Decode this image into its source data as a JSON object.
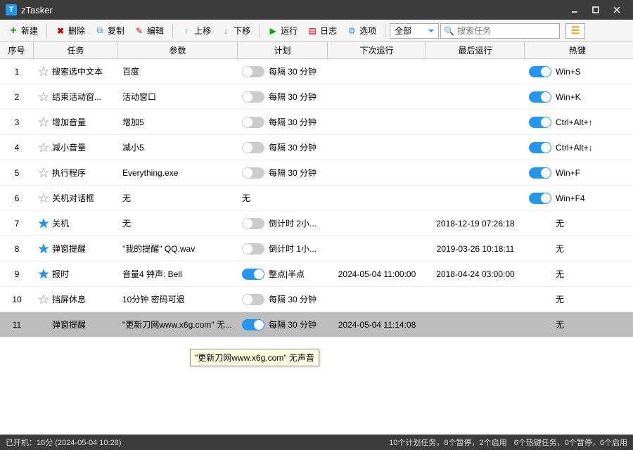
{
  "title": "zTasker",
  "toolbar": {
    "new": "新建",
    "delete": "删除",
    "copy": "复制",
    "edit": "编辑",
    "up": "上移",
    "down": "下移",
    "run": "运行",
    "log": "日志",
    "options": "选项",
    "filter_selected": "全部",
    "search_placeholder": "搜索任务"
  },
  "columns": {
    "num": "序号",
    "task": "任务",
    "param": "参数",
    "plan": "计划",
    "next": "下次运行",
    "last": "最后运行",
    "hotkey": "热键"
  },
  "rows": [
    {
      "num": "1",
      "starred": false,
      "task": "搜索选中文本",
      "param": "百度",
      "planOn": false,
      "plan": "每隔 30 分钟",
      "next": "",
      "last": "",
      "hkOn": true,
      "hotkey": "Win+S"
    },
    {
      "num": "2",
      "starred": false,
      "task": "结束活动窗...",
      "param": "活动窗口",
      "planOn": false,
      "plan": "每隔 30 分钟",
      "next": "",
      "last": "",
      "hkOn": true,
      "hotkey": "Win+K"
    },
    {
      "num": "3",
      "starred": false,
      "task": "增加音量",
      "param": "增加5",
      "planOn": false,
      "plan": "每隔 30 分钟",
      "next": "",
      "last": "",
      "hkOn": true,
      "hotkey": "Ctrl+Alt+↑"
    },
    {
      "num": "4",
      "starred": false,
      "task": "减小音量",
      "param": "减小5",
      "planOn": false,
      "plan": "每隔 30 分钟",
      "next": "",
      "last": "",
      "hkOn": true,
      "hotkey": "Ctrl+Alt+↓"
    },
    {
      "num": "5",
      "starred": false,
      "task": "执行程序",
      "param": "Everything.exe",
      "planOn": false,
      "plan": "每隔 30 分钟",
      "next": "",
      "last": "",
      "hkOn": true,
      "hotkey": "Win+F"
    },
    {
      "num": "6",
      "starred": false,
      "task": "关机对话框",
      "param": "无",
      "planOn": false,
      "plan": "无",
      "next": "",
      "last": "",
      "hkOn": true,
      "hotkey": "Win+F4"
    },
    {
      "num": "7",
      "starred": true,
      "task": "关机",
      "param": "无",
      "planOn": false,
      "plan": "倒计时 2小...",
      "next": "",
      "last": "2018-12-19 07:26:18",
      "hkOn": false,
      "hotkey": "无"
    },
    {
      "num": "8",
      "starred": true,
      "task": "弹窗提醒",
      "param": "\"我的提醒\" QQ.wav",
      "planOn": false,
      "plan": "倒计时 1小...",
      "next": "",
      "last": "2019-03-26 10:18:11",
      "hkOn": false,
      "hotkey": "无"
    },
    {
      "num": "9",
      "starred": true,
      "task": "报时",
      "param": "音量4 钟声: Bell",
      "planOn": true,
      "plan": "整点|半点",
      "next": "2024-05-04 11:00:00",
      "last": "2018-04-24 03:00:00",
      "hkOn": false,
      "hotkey": "无"
    },
    {
      "num": "10",
      "starred": false,
      "task": "挡屏休息",
      "param": "10分钟 密码可退",
      "planOn": false,
      "plan": "每隔 30 分钟",
      "next": "",
      "last": "",
      "hkOn": false,
      "hotkey": "无"
    },
    {
      "num": "11",
      "starred": false,
      "task": "弹窗提醒",
      "param": "\"更新刀网www.x6g.com\" 无...",
      "planOn": true,
      "plan": "每隔 30 分钟",
      "next": "2024-05-04 11:14:08",
      "last": "",
      "hkOn": false,
      "hotkey": "无",
      "selected": true
    }
  ],
  "tooltip": "\"更新刀网www.x6g.com\" 无声音",
  "status": {
    "left": "已开机：16分 (2024-05-04 10:28)",
    "right1": "10个计划任务，8个暂停，2个启用",
    "right2": "6个热键任务，0个暂停，6个启用"
  }
}
